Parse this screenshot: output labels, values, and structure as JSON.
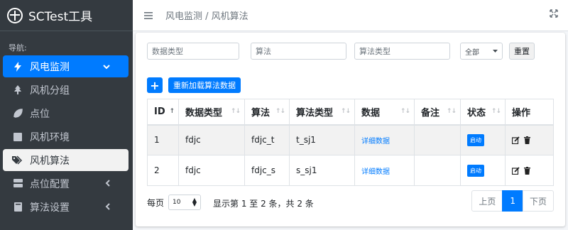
{
  "app": {
    "title": "SCTest工具"
  },
  "sidebar": {
    "header": "导航:",
    "items": [
      {
        "label": "风电监测",
        "icon": "bolt-icon",
        "active": true
      },
      {
        "label": "风机分组",
        "icon": "tree-icon"
      },
      {
        "label": "点位",
        "icon": "leaf-icon"
      },
      {
        "label": "风机环境",
        "icon": "square-icon"
      },
      {
        "label": "风机算法",
        "icon": "tags-icon",
        "highlight": true
      },
      {
        "label": "点位配置",
        "icon": "server-icon"
      },
      {
        "label": "算法设置",
        "icon": "book-icon"
      }
    ]
  },
  "topbar": {
    "breadcrumb": "风电监测 / 风机算法"
  },
  "filters": {
    "data_type_placeholder": "数据类型",
    "algorithm_placeholder": "算法",
    "algorithm_type_placeholder": "算法类型",
    "select_value": "全部",
    "reset_label": "重置"
  },
  "toolbar": {
    "add_label": "+",
    "reload_label": "重新加载算法数据"
  },
  "table": {
    "columns": [
      "ID",
      "数据类型",
      "算法",
      "算法类型",
      "数据",
      "备注",
      "状态",
      "操作"
    ],
    "rows": [
      {
        "id": "1",
        "data_type": "fdjc",
        "algorithm": "fdjc_t",
        "algorithm_type": "t_sj1",
        "data": "详细数据",
        "remark": "",
        "status": "启动"
      },
      {
        "id": "2",
        "data_type": "fdjc",
        "algorithm": "fdjc_s",
        "algorithm_type": "s_sj1",
        "data": "详细数据",
        "remark": "",
        "status": "启动"
      }
    ]
  },
  "footer": {
    "per_page_label": "每页",
    "per_page_value": "10",
    "info": "显示第 1 至 2 条，共 2 条",
    "prev": "上页",
    "page": "1",
    "next": "下页"
  },
  "colors": {
    "accent": "#007bff",
    "sidebar_bg": "#343a40"
  }
}
